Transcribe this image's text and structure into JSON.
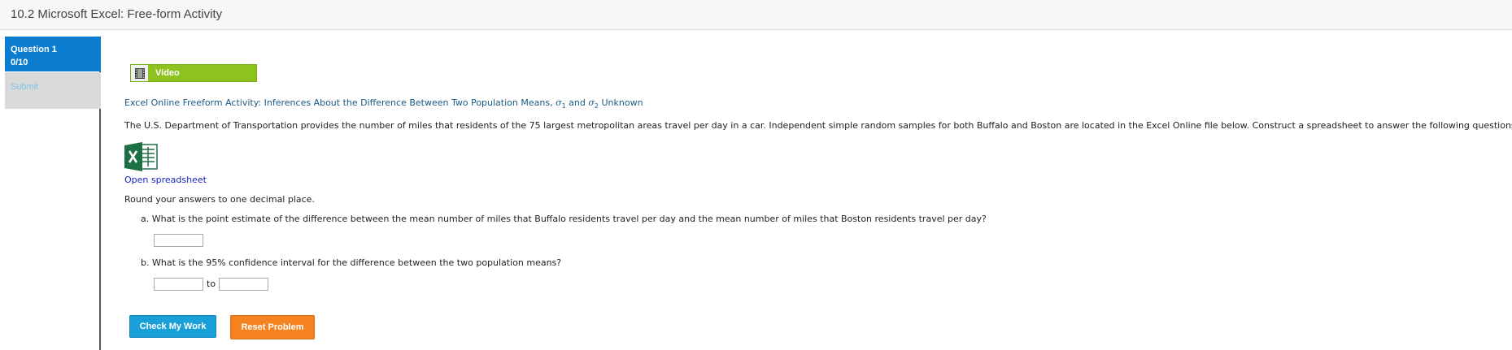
{
  "window": {
    "title": "10.2 Microsoft Excel: Free-form Activity"
  },
  "sidebar": {
    "question_label": "Question 1",
    "score": "0/10",
    "submit_label": "Submit"
  },
  "video": {
    "label": "Video"
  },
  "activity": {
    "title_prefix": "Excel Online Freeform Activity: Inferences About the Difference Between Two Population Means, ",
    "sigma": "σ",
    "sub1": "1",
    "and": " and ",
    "sub2": "2",
    "title_suffix": " Unknown",
    "description": "The U.S. Department of Transportation provides the number of miles that residents of the 75 largest metropolitan areas travel per day in a car. Independent simple random samples for both Buffalo and Boston are located in the Excel Online file below. Construct a spreadsheet to answer the following questions.",
    "open_link": "Open spreadsheet",
    "round_note": "Round your answers to one decimal place.",
    "question_a": "a. What is the point estimate of the difference between the mean number of miles that Buffalo residents travel per day and the mean number of miles that Boston residents travel per day?",
    "question_b": "b. What is the 95% confidence interval for the difference between the two population means?",
    "to_label": "to",
    "answer_a": "",
    "answer_b_low": "",
    "answer_b_high": ""
  },
  "buttons": {
    "check": "Check My Work",
    "reset": "Reset Problem"
  },
  "colors": {
    "tab_blue": "#0c7cd1",
    "video_green": "#8dc21f",
    "check_blue": "#1a9fd9",
    "reset_orange": "#f5821f",
    "excel_green": "#1d7044"
  },
  "icons": {
    "video": "film-icon",
    "excel": "excel-icon"
  }
}
